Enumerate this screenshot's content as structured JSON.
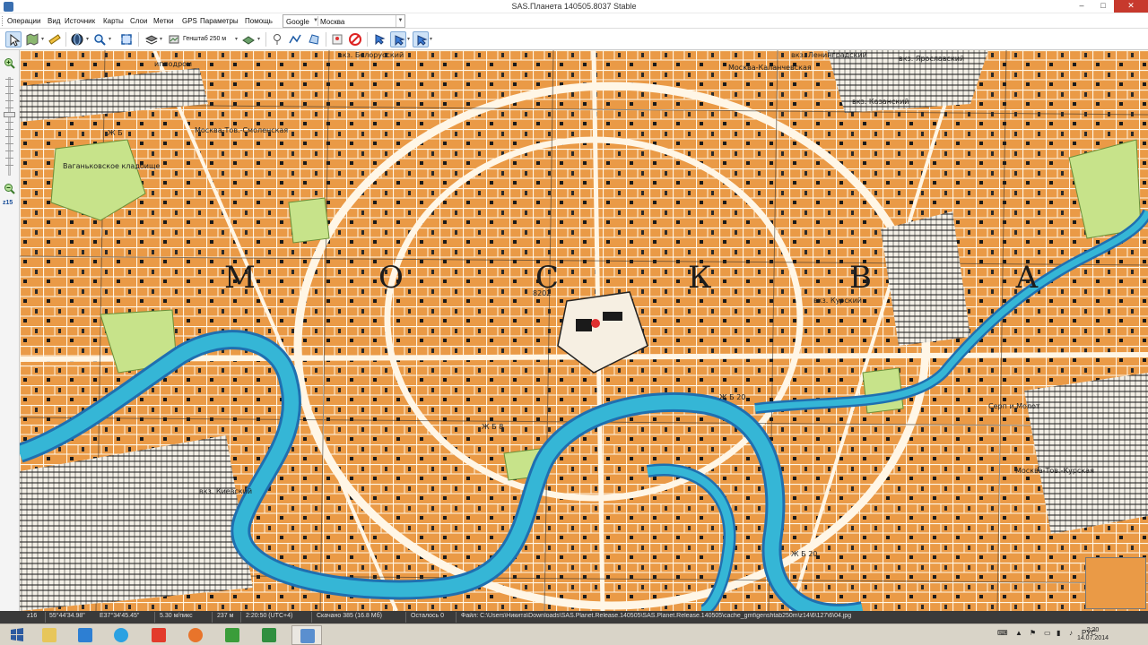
{
  "window": {
    "title": "SAS.Планета 140505.8037 Stable",
    "minimize": "–",
    "maximize": "□",
    "close": "✕"
  },
  "menu": {
    "items": [
      "Операции",
      "Вид",
      "Источник",
      "Карты",
      "Слои",
      "Метки",
      "GPS",
      "Параметры",
      "Помощь"
    ],
    "map_source": "Google",
    "map_name": "Москва"
  },
  "toolbar": {
    "zoom_map": "Генштаб 250 м"
  },
  "zoom_panel": {
    "level": "z15"
  },
  "map": {
    "words": [
      "М",
      "О",
      "С",
      "К",
      "В",
      "А"
    ],
    "labels": [
      "ипподром",
      "Москва-Тов.-Смоленская",
      "Ваганьковское кладбище",
      "вкз. Белорусский",
      "вкз. Ленинградский",
      "вкз. Ярославский",
      "вкз. Казанский",
      "Москва-Каланчевская",
      "вкз. Курский",
      "вкз. Киевский",
      "Москва-Тов.-Курская",
      "Серп и Молот",
      "8202",
      "Ж Б",
      "Ж Б 20",
      "Ж Б 20",
      "Ж Б 8"
    ]
  },
  "status": {
    "zoom": "z16",
    "lat": "55°44'34.98\"",
    "lon": "E37°34'45.45\"",
    "scale": "5.30 м/пикс",
    "distance": "237 м",
    "time": "2:20:50 (UTC+4)",
    "downloaded": "Скачано 385 (16.8 Мб)",
    "remaining": "Осталось 0",
    "file": "Файл: C:\\Users\\Никита\\Downloads\\SAS.Planet.Release.140505\\SAS.Planet.Release.140505\\cache_gmt\\genshtab250m\\z14\\6\\127\\6\\04.jpg"
  },
  "taskbar": {
    "lang": "РУС",
    "time": "2:20",
    "date": "14.07.2014"
  }
}
